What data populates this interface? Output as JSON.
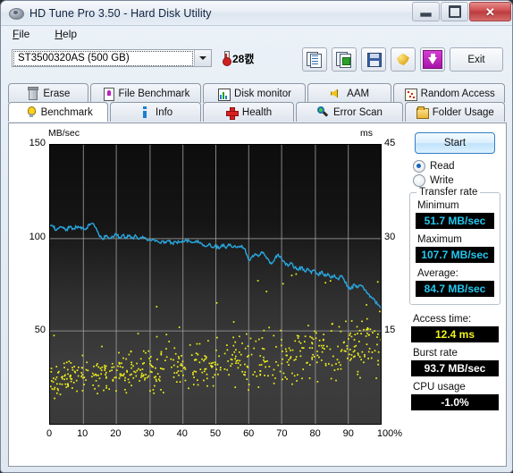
{
  "window": {
    "title": "HD Tune Pro 3.50 - Hard Disk Utility",
    "icon": "hard-disk-icon",
    "minimize": "–",
    "maximize": "□",
    "close": "✕"
  },
  "menu": {
    "items": [
      {
        "label": "File",
        "accel": "F"
      },
      {
        "label": "Help",
        "accel": "H"
      }
    ]
  },
  "toolbar": {
    "drive_select": {
      "value": "ST3500320AS (500 GB)",
      "arrow": "chevron-down-icon"
    },
    "temperature": "28캜",
    "buttons": [
      {
        "name": "copy-text-button",
        "icon": "copy-document-icon"
      },
      {
        "name": "copy-image-button",
        "icon": "copy-screenshot-icon"
      },
      {
        "name": "save-button",
        "icon": "floppy-disk-icon"
      },
      {
        "name": "options-button",
        "icon": "keys-icon"
      },
      {
        "name": "download-button",
        "icon": "down-arrow-icon"
      }
    ],
    "exit_label": "Exit"
  },
  "tabs": {
    "row1": [
      {
        "label": "Erase",
        "icon": "trash-icon",
        "active": false
      },
      {
        "label": "File Benchmark",
        "icon": "file-benchmark-icon",
        "active": false
      },
      {
        "label": "Disk monitor",
        "icon": "bar-chart-icon",
        "active": false
      },
      {
        "label": "AAM",
        "icon": "speaker-icon",
        "active": false
      },
      {
        "label": "Random Access",
        "icon": "scatter-icon",
        "active": false
      }
    ],
    "row2": [
      {
        "label": "Benchmark",
        "icon": "lightbulb-icon",
        "active": true
      },
      {
        "label": "Info",
        "icon": "info-icon",
        "active": false
      },
      {
        "label": "Health",
        "icon": "health-cross-icon",
        "active": false
      },
      {
        "label": "Error Scan",
        "icon": "magnifier-icon",
        "active": false
      },
      {
        "label": "Folder Usage",
        "icon": "folder-icon",
        "active": false
      }
    ]
  },
  "sidebar": {
    "start_label": "Start",
    "mode": [
      {
        "label": "Read",
        "selected": true
      },
      {
        "label": "Write",
        "selected": false
      }
    ],
    "transfer_rate": {
      "group_title": "Transfer rate",
      "minimum_label": "Minimum",
      "minimum_value": "51.7 MB/sec",
      "maximum_label": "Maximum",
      "maximum_value": "107.7 MB/sec",
      "average_label": "Average:",
      "average_value": "84.7 MB/sec"
    },
    "access_time_label": "Access time:",
    "access_time_value": "12.4 ms",
    "burst_rate_label": "Burst rate",
    "burst_rate_value": "93.7 MB/sec",
    "cpu_usage_label": "CPU usage",
    "cpu_usage_value": "-1.0%"
  },
  "colors": {
    "transfer_curve": "#29a8e0",
    "access_dots": "#f2f21a",
    "plot_background": "#1a1a1a",
    "gridline": "#9a9a9a",
    "value_cyan": "#22c8f0",
    "value_yellow": "#f2f21a",
    "accent": "#2f7fc4"
  },
  "chart_data": {
    "type": "line",
    "title": "",
    "ylabel": "MB/sec",
    "y2label": "ms",
    "xlabel": "%",
    "xlim": [
      0,
      100
    ],
    "ylim": [
      0,
      150
    ],
    "y2lim": [
      0,
      45
    ],
    "xticks": [
      0,
      10,
      20,
      30,
      40,
      50,
      60,
      70,
      80,
      90,
      100
    ],
    "xticklabels": [
      "0",
      "10",
      "20",
      "30",
      "40",
      "50",
      "60",
      "70",
      "80",
      "90",
      "100%"
    ],
    "yticks": [
      50,
      100,
      150
    ],
    "y2ticks": [
      15,
      30,
      45
    ],
    "grid": true,
    "legend": null,
    "series": [
      {
        "name": "Transfer rate",
        "unit": "MB/sec",
        "color": "#29a8e0",
        "axis": "left",
        "x": [
          0,
          1,
          2,
          3,
          4,
          5,
          6,
          7,
          8,
          9,
          10,
          11,
          12,
          13,
          14,
          15,
          16,
          17,
          18,
          19,
          20,
          21,
          22,
          23,
          24,
          25,
          26,
          27,
          28,
          29,
          30,
          31,
          32,
          33,
          34,
          35,
          36,
          37,
          38,
          39,
          40,
          41,
          42,
          43,
          44,
          45,
          46,
          47,
          48,
          49,
          50,
          51,
          52,
          53,
          54,
          55,
          56,
          57,
          58,
          59,
          60,
          61,
          62,
          63,
          64,
          65,
          66,
          67,
          68,
          69,
          70,
          71,
          72,
          73,
          74,
          75,
          76,
          77,
          78,
          79,
          80,
          81,
          82,
          83,
          84,
          85,
          86,
          87,
          88,
          89,
          90,
          91,
          92,
          93,
          94,
          95,
          96,
          97,
          98,
          99,
          100
        ],
        "values": [
          106.5,
          105.8,
          104.2,
          106.0,
          105.2,
          104.5,
          106.2,
          105.0,
          105.8,
          105.5,
          105.4,
          105.2,
          106.8,
          107.7,
          105.0,
          100.6,
          99.2,
          101.3,
          99.6,
          100.5,
          101.8,
          100.2,
          101.6,
          100.2,
          101.4,
          99.8,
          101.0,
          99.5,
          100.8,
          99.4,
          98.9,
          99.2,
          98.3,
          97.5,
          98.3,
          97.3,
          98.2,
          97.0,
          98.0,
          97.6,
          98.4,
          99.0,
          98.2,
          97.6,
          98.3,
          97.5,
          96.8,
          95.4,
          96.6,
          95.0,
          96.2,
          94.4,
          96.3,
          94.8,
          96.6,
          95.0,
          95.6,
          95.4,
          95.8,
          94.0,
          88.2,
          89.5,
          91.4,
          90.0,
          92.5,
          90.4,
          88.4,
          86.0,
          88.8,
          91.2,
          89.0,
          86.6,
          84.8,
          86.5,
          84.0,
          82.6,
          84.4,
          82.0,
          83.4,
          81.0,
          82.6,
          80.2,
          81.8,
          79.5,
          80.8,
          78.4,
          80.0,
          78.0,
          79.4,
          77.0,
          74.0,
          72.4,
          75.0,
          73.2,
          74.6,
          72.0,
          70.4,
          68.5,
          66.8,
          64.2,
          62.0
        ]
      },
      {
        "name": "Access time",
        "unit": "ms",
        "color": "#f2f21a",
        "axis": "right",
        "type": "scatter",
        "average": 12.4,
        "range": [
          3.0,
          26.0
        ],
        "n_points": 580,
        "description": "Yellow scatter of access-time samples, rising from ~4-14 ms near 0% to ~10-22 ms near 100%"
      }
    ]
  }
}
